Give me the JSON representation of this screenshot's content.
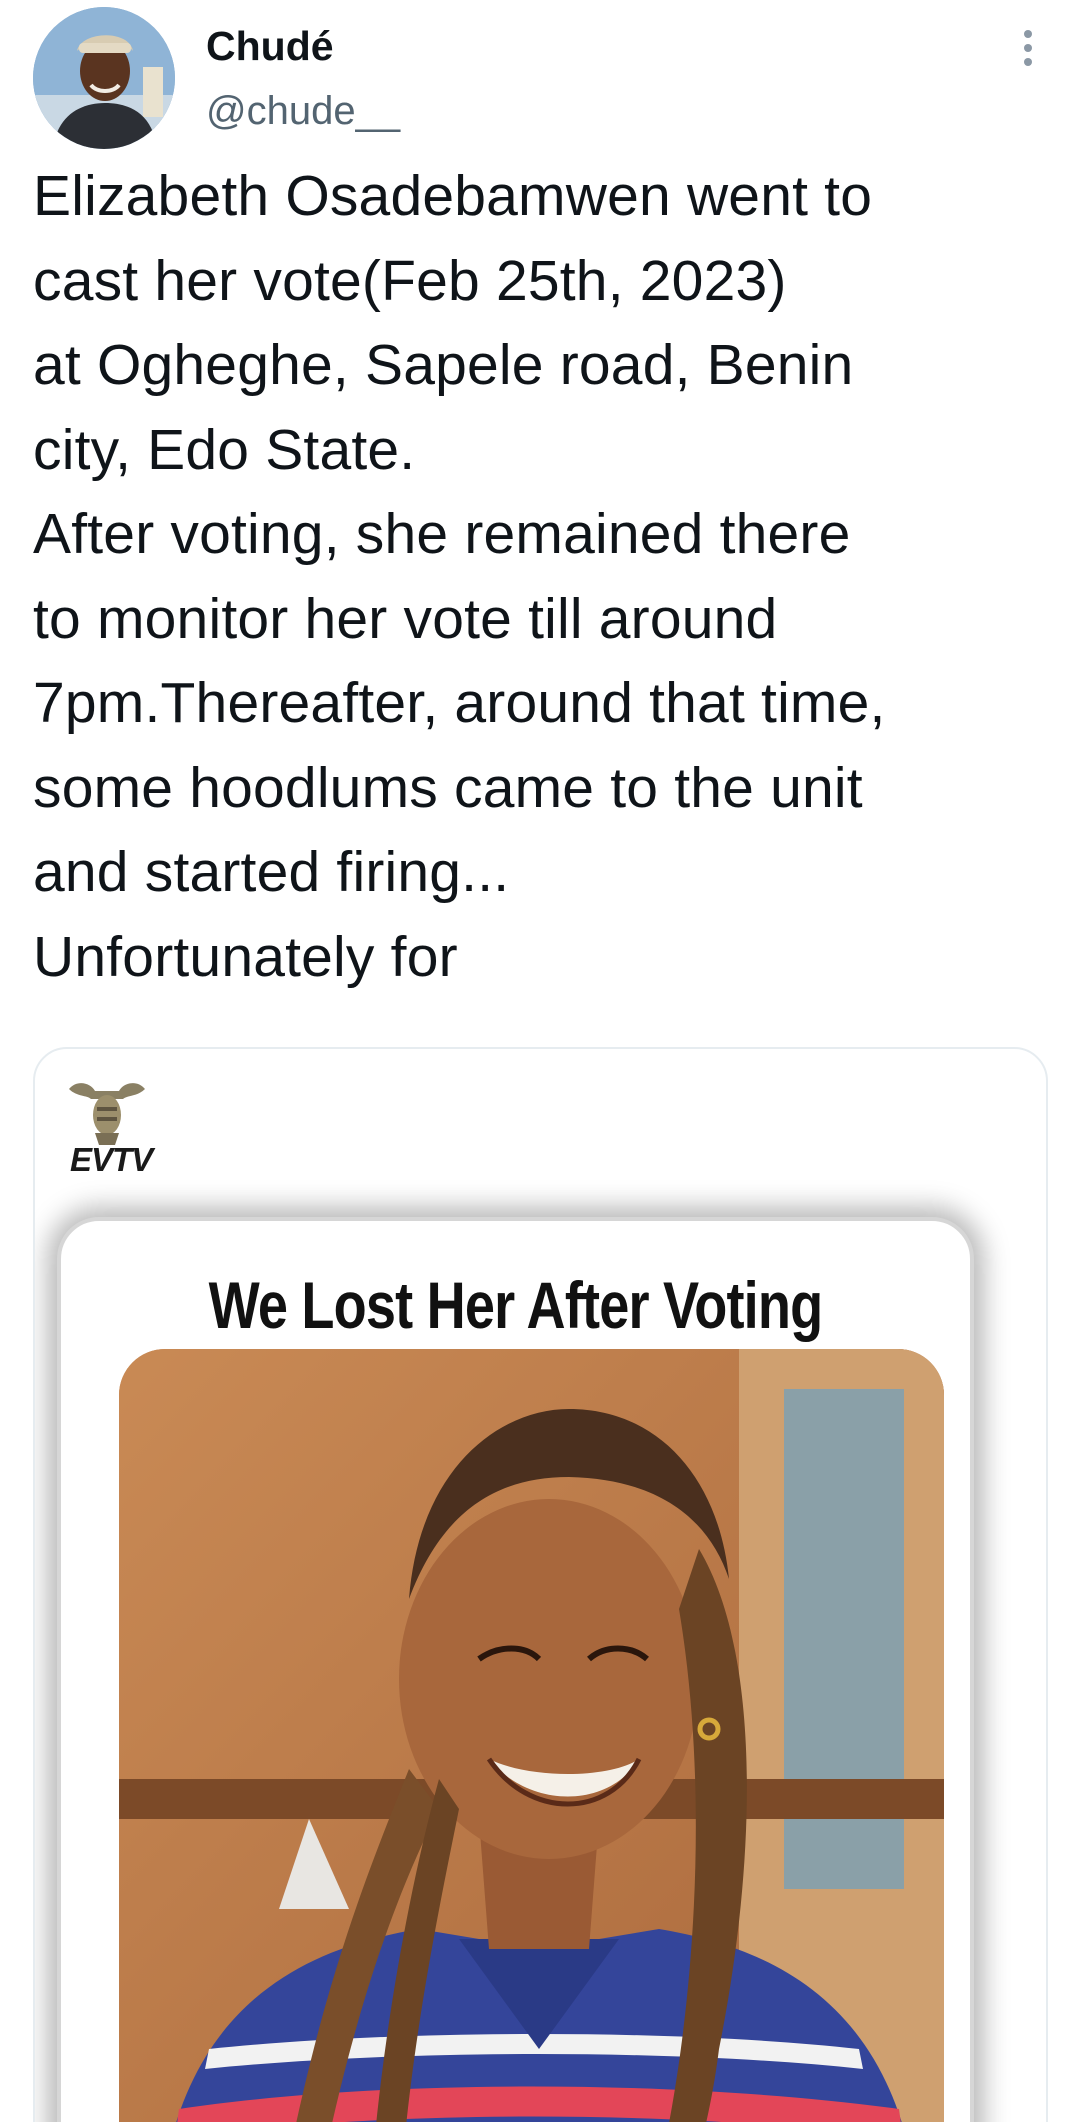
{
  "tweet": {
    "author_name": "Chudé",
    "author_handle": "@chude__",
    "text": "Elizabeth Osadebamwen went to\ncast her vote(Feb 25th, 2023)\nat Ogheghe,  Sapele road, Benin\ncity, Edo State.\nAfter voting, she remained there\nto monitor her vote till around\n7pm.Thereafter, around that time,\nsome hoodlums came to the unit\nand started firing...\nUnfortunately for"
  },
  "media": {
    "logo_text": "EVTV",
    "headline": "We Lost Her After Voting"
  },
  "icons": {
    "more": "more-vertical-icon",
    "logo": "mask-logo-icon"
  },
  "colors": {
    "text": "#0f1419",
    "secondary_text": "#536471",
    "border": "#e6ecf0"
  }
}
